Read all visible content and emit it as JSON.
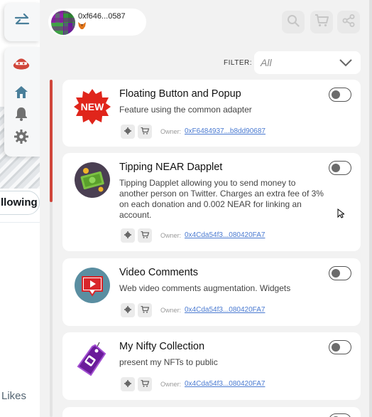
{
  "background_page": {
    "follow_label": "llowing",
    "likes_label": "Likes"
  },
  "side_nav": {
    "toggle_icon": "swap-arrows-icon",
    "items": [
      {
        "icon": "dapplets-logo-icon"
      },
      {
        "icon": "home-icon"
      },
      {
        "icon": "bell-icon"
      },
      {
        "icon": "gear-icon"
      }
    ]
  },
  "header": {
    "user": {
      "address": "0xf646...0587",
      "wallet_icon": "metamask-fox-icon"
    },
    "buttons": [
      {
        "icon": "search-icon"
      },
      {
        "icon": "cart-icon"
      },
      {
        "icon": "share-icon"
      }
    ]
  },
  "filter": {
    "label": "FILTER:",
    "value": "All"
  },
  "cards": [
    {
      "title": "Floating Button and Popup",
      "description": "Feature using the common adapter",
      "owner_label": "Owner:",
      "owner": "0xF6484937...b8dd90687",
      "icon": "new-badge-icon",
      "enabled": false
    },
    {
      "title": "Tipping NEAR Dapplet",
      "description": "Tipping Dapplet allowing you to send money to another person on Twitter. Charges an extra fee of 3% on each donation and 0.002 NEAR for linking an account.",
      "owner_label": "Owner:",
      "owner": "0x4Cda54f3...080420FA7",
      "icon": "money-icon",
      "enabled": false
    },
    {
      "title": "Video Comments",
      "description": "Web video comments augmentation. Widgets",
      "owner_label": "Owner:",
      "owner": "0x4Cda54f3...080420FA7",
      "icon": "video-play-icon",
      "enabled": false
    },
    {
      "title": "My Nifty Collection",
      "description": "present my NFTs to public",
      "owner_label": "Owner:",
      "owner": "0x4Cda54f3...080420FA7",
      "icon": "nft-tag-icon",
      "enabled": false
    }
  ],
  "colors": {
    "accent": "#d0463b",
    "link": "#4a7ad1",
    "panel_bg": "#f2f2f2"
  }
}
